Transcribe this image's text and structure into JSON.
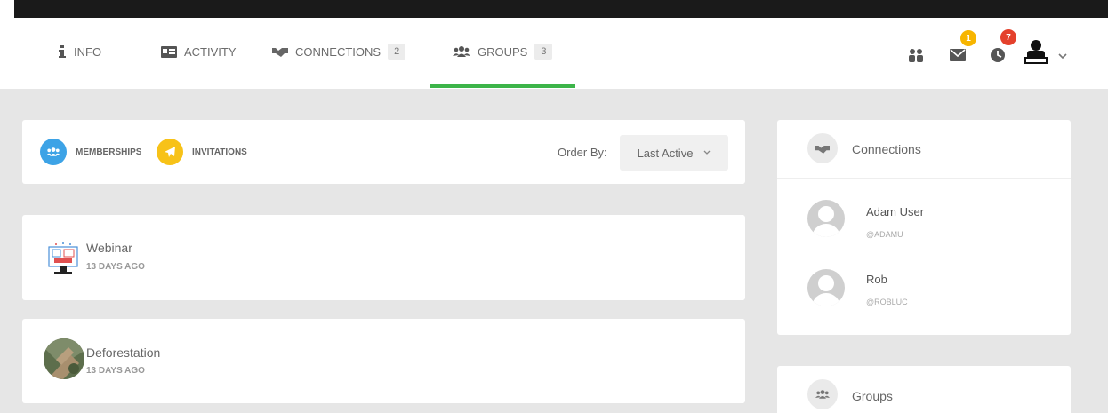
{
  "nav": {
    "tabs": [
      {
        "label": "INFO",
        "icon": "info-icon"
      },
      {
        "label": "ACTIVITY",
        "icon": "id-card-icon"
      },
      {
        "label": "CONNECTIONS",
        "icon": "handshake-icon",
        "count": "2"
      },
      {
        "label": "GROUPS",
        "icon": "users-icon",
        "count": "3"
      }
    ],
    "active_tab": "GROUPS",
    "accent": "#3cb449",
    "messages_badge": "1",
    "notifications_badge": "7",
    "messages_badge_color": "#f7b500",
    "notifications_badge_color": "#e4412c"
  },
  "filter": {
    "memberships_label": "MEMBERSHIPS",
    "invitations_label": "INVITATIONS",
    "order_by_label": "Order By:",
    "order_by_value": "Last Active",
    "memberships_color": "#3da3e6",
    "invitations_color": "#f7c218"
  },
  "groups": [
    {
      "name": "Webinar",
      "last_active": "13 DAYS AGO",
      "icon": "webinar-icon"
    },
    {
      "name": "Deforestation",
      "last_active": "13 DAYS AGO",
      "icon": "deforestation-photo"
    }
  ],
  "connections_widget": {
    "title": "Connections",
    "members": [
      {
        "name": "Adam User",
        "handle": "@ADAMU"
      },
      {
        "name": "Rob",
        "handle": "@ROBLUC"
      }
    ]
  },
  "groups_widget": {
    "title": "Groups"
  }
}
